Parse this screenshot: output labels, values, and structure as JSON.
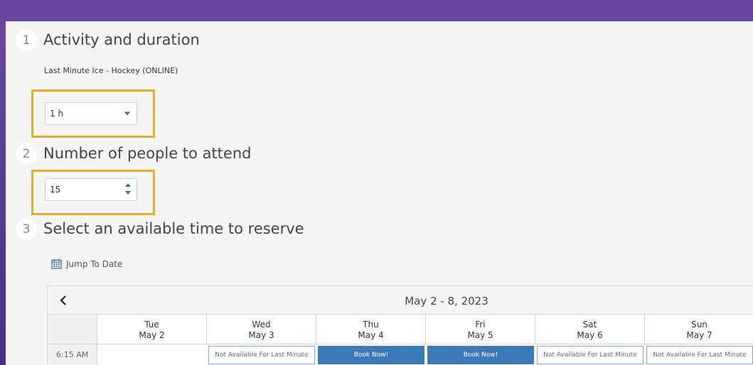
{
  "steps": [
    {
      "number": "1",
      "title": "Activity and duration"
    },
    {
      "number": "2",
      "title": "Number of people to attend"
    },
    {
      "number": "3",
      "title": "Select an available time to reserve"
    }
  ],
  "activity": {
    "name": "Last Minute Ice - Hockey (ONLINE)"
  },
  "duration": {
    "value": "1 h"
  },
  "people": {
    "value": "15"
  },
  "jump_to_date": {
    "label": "Jump To Date"
  },
  "calendar": {
    "prev_icon": "chevron-left-icon",
    "range_label": "May 2 - 8, 2023",
    "days": [
      {
        "weekday": "Tue",
        "date": "May 2"
      },
      {
        "weekday": "Wed",
        "date": "May 3"
      },
      {
        "weekday": "Thu",
        "date": "May 4"
      },
      {
        "weekday": "Fri",
        "date": "May 5"
      },
      {
        "weekday": "Sat",
        "date": "May 6"
      },
      {
        "weekday": "Sun",
        "date": "May 7"
      }
    ],
    "rows": [
      {
        "time": "6:15 AM",
        "slots": [
          "",
          "Not Available For Last Minute",
          "Book Now!",
          "Book Now!",
          "Not Available For Last Minute",
          "Not Available For Last Minute"
        ]
      }
    ]
  },
  "colors": {
    "header": "#6a47a0",
    "highlight": "#e8ac2a",
    "book_button": "#3a7ab8"
  }
}
